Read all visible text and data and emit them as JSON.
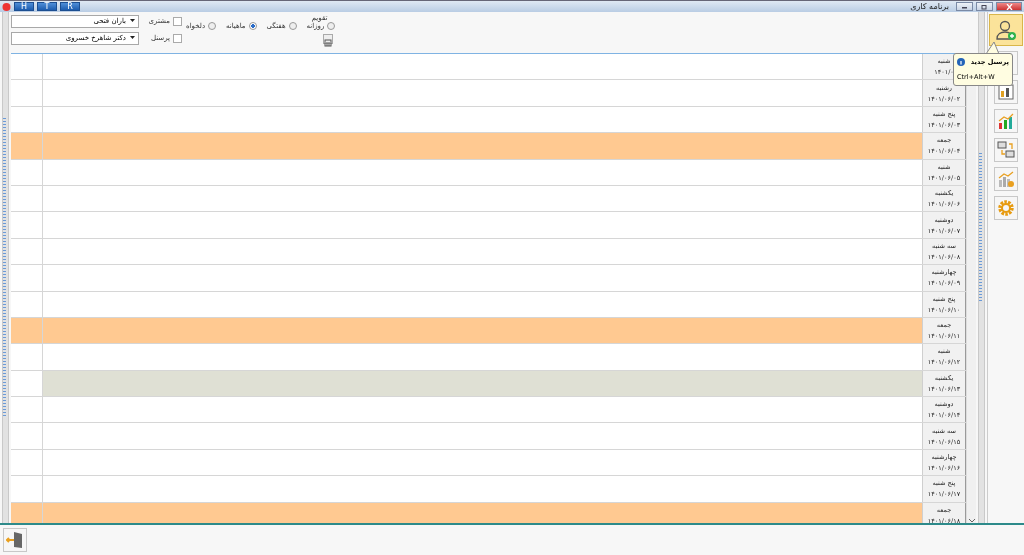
{
  "window": {
    "title": "برنامه کاری",
    "left_buttons": [
      "R",
      "T",
      "H"
    ]
  },
  "filters": {
    "customer": {
      "label": "مشتری",
      "checked": false,
      "value": "باران فتحی"
    },
    "staff": {
      "label": "پرسنل",
      "checked": false,
      "value": "دکتر شاهرخ خسروی"
    },
    "calendar": {
      "title": "تقویم",
      "options": [
        {
          "label": "روزانه",
          "selected": false
        },
        {
          "label": "هفتگی",
          "selected": false
        },
        {
          "label": "ماهیانه",
          "selected": true
        },
        {
          "label": "دلخواه",
          "selected": false
        }
      ]
    }
  },
  "rows": [
    {
      "day": "شنبه",
      "date": "۱۴۰۱/۰",
      "kind": "normal"
    },
    {
      "day": "رشنبه",
      "date": "۱۴۰۱/۰۶/۰۲",
      "kind": "normal"
    },
    {
      "day": "پنج شنبه",
      "date": "۱۴۰۱/۰۶/۰۳",
      "kind": "normal"
    },
    {
      "day": "جمعه",
      "date": "۱۴۰۱/۰۶/۰۴",
      "kind": "holiday"
    },
    {
      "day": "شنبه",
      "date": "۱۴۰۱/۰۶/۰۵",
      "kind": "normal"
    },
    {
      "day": "یکشنبه",
      "date": "۱۴۰۱/۰۶/۰۶",
      "kind": "normal"
    },
    {
      "day": "دوشنبه",
      "date": "۱۴۰۱/۰۶/۰۷",
      "kind": "normal"
    },
    {
      "day": "سه شنبه",
      "date": "۱۴۰۱/۰۶/۰۸",
      "kind": "normal"
    },
    {
      "day": "چهارشنبه",
      "date": "۱۴۰۱/۰۶/۰۹",
      "kind": "normal"
    },
    {
      "day": "پنج شنبه",
      "date": "۱۴۰۱/۰۶/۱۰",
      "kind": "normal"
    },
    {
      "day": "جمعه",
      "date": "۱۴۰۱/۰۶/۱۱",
      "kind": "holiday"
    },
    {
      "day": "شنبه",
      "date": "۱۴۰۱/۰۶/۱۲",
      "kind": "normal"
    },
    {
      "day": "یکشنبه",
      "date": "۱۴۰۱/۰۶/۱۳",
      "kind": "today"
    },
    {
      "day": "دوشنبه",
      "date": "۱۴۰۱/۰۶/۱۴",
      "kind": "normal"
    },
    {
      "day": "سه شنبه",
      "date": "۱۴۰۱/۰۶/۱۵",
      "kind": "normal"
    },
    {
      "day": "چهارشنبه",
      "date": "۱۴۰۱/۰۶/۱۶",
      "kind": "normal"
    },
    {
      "day": "پنج شنبه",
      "date": "۱۴۰۱/۰۶/۱۷",
      "kind": "normal"
    },
    {
      "day": "جمعه",
      "date": "۱۴۰۱/۰۶/۱۸",
      "kind": "holiday"
    }
  ],
  "sidebar": {
    "items": [
      {
        "kind": "user-add",
        "selected": true
      },
      {
        "kind": "blank",
        "selected": false
      },
      {
        "kind": "report",
        "selected": false
      },
      {
        "kind": "chart",
        "selected": false
      },
      {
        "kind": "network",
        "selected": false
      },
      {
        "kind": "growth",
        "selected": false
      },
      {
        "kind": "settings",
        "selected": false
      }
    ]
  },
  "tooltip": {
    "title": "پرسنل جدید",
    "shortcut": "Ctrl+Alt+W"
  }
}
